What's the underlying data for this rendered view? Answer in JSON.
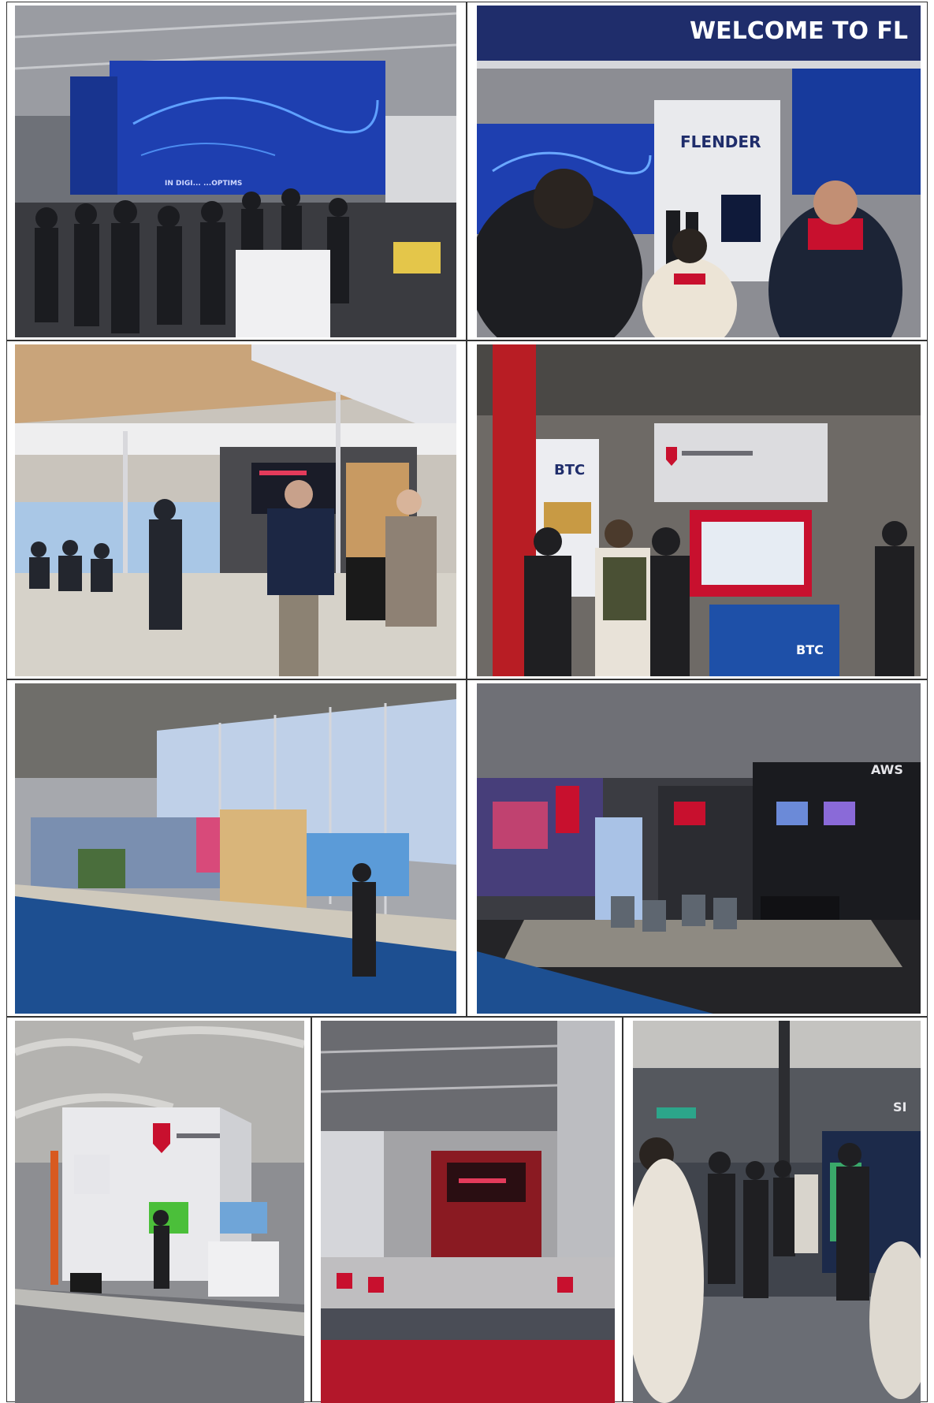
{
  "page": {
    "background": "#ffffff",
    "border_color": "#333333"
  },
  "photos": [
    {
      "id": "photo-1",
      "subject": "crowd at exhibition stand under large blue LED screen",
      "caption_text": "IN DIGI...  ...OPTIMS"
    },
    {
      "id": "photo-2",
      "subject": "Flender booth with welcome banner",
      "banner_text": "WELCOME TO FL",
      "brand_text": "FLENDER"
    },
    {
      "id": "photo-3",
      "subject": "seminar stage with seated audience and truss lighting"
    },
    {
      "id": "photo-4",
      "subject": "Niedersachsen booth with BTC display",
      "brand_text": "BTC",
      "counter_text": "BTC"
    },
    {
      "id": "photo-5",
      "subject": "long exhibition hall aisle with blue carpet"
    },
    {
      "id": "photo-6",
      "subject": "dark booth with lounge seating",
      "brand_text": "AWS"
    },
    {
      "id": "photo-7",
      "subject": "white Niedersachsen cube booth"
    },
    {
      "id": "photo-8",
      "subject": "red stage with curtains and red carpet aisle"
    },
    {
      "id": "photo-9",
      "subject": "visitors standing in dark exhibition hall",
      "brand_text": "SI"
    }
  ],
  "colors": {
    "led_blue": "#1e3fb0",
    "navy": "#1f2d6b",
    "red": "#c8102e",
    "carpet_blue": "#1d4f91",
    "carpet_red": "#b3172a"
  }
}
